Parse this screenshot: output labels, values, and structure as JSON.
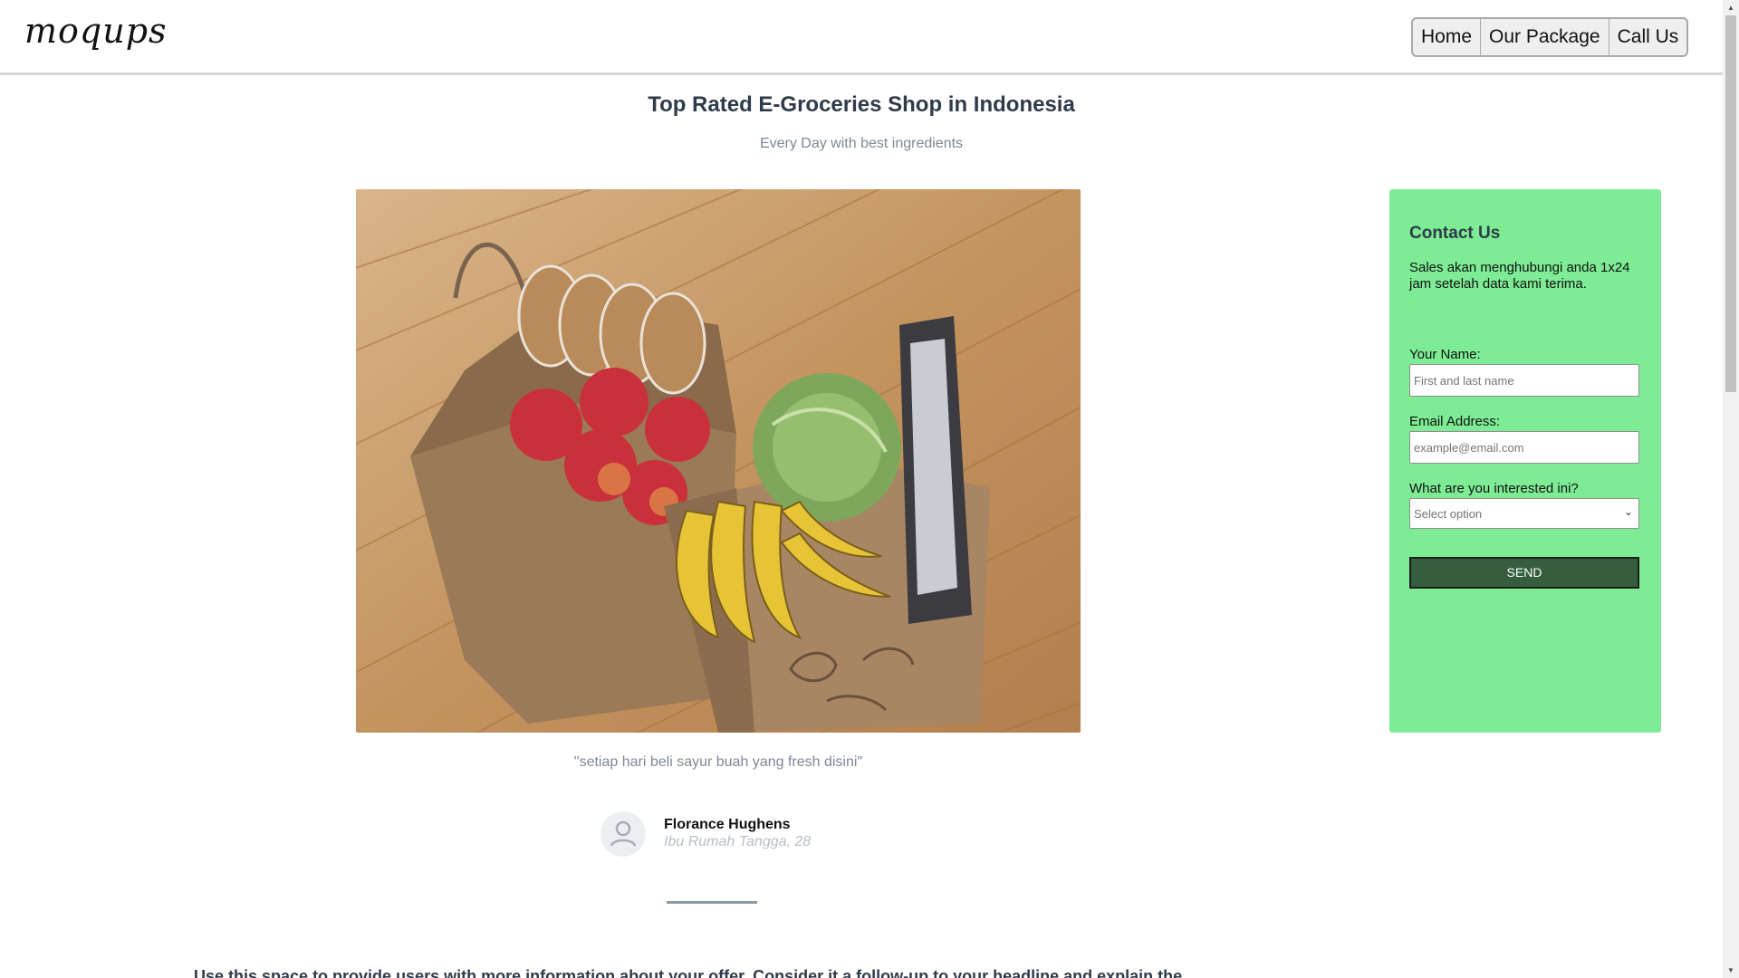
{
  "header": {
    "logo_text": "moqups",
    "nav": [
      "Home",
      "Our Package",
      "Call Us"
    ]
  },
  "hero": {
    "title": "Top Rated E-Groceries Shop in Indonesia",
    "subtitle": "Every Day with best ingredients"
  },
  "contact": {
    "title": "Contact Us",
    "description": "Sales akan menghubungi anda 1x24 jam setelah data kami terima.",
    "name_label": "Your Name:",
    "name_placeholder": "First and last name",
    "email_label": "Email Address:",
    "email_placeholder": "example@email.com",
    "interest_label": "What are you interested ini?",
    "interest_selected": "Select option",
    "send_label": "SEND",
    "panel_color": "#7dec94",
    "send_color": "#355e3f"
  },
  "testimonial": {
    "quote": "\"setiap hari beli sayur buah yang fresh disini\"",
    "name": "Florance Hughens",
    "role": "Ibu Rumah Tangga, 28"
  },
  "body": {
    "text": "Use this space to provide users with more information about your offer. Consider it a follow-up to your headline and explain the"
  },
  "icons": {
    "avatar": "user-avatar-icon",
    "select": "chevron-down-icon",
    "photo": "grocery-bags-photo"
  }
}
